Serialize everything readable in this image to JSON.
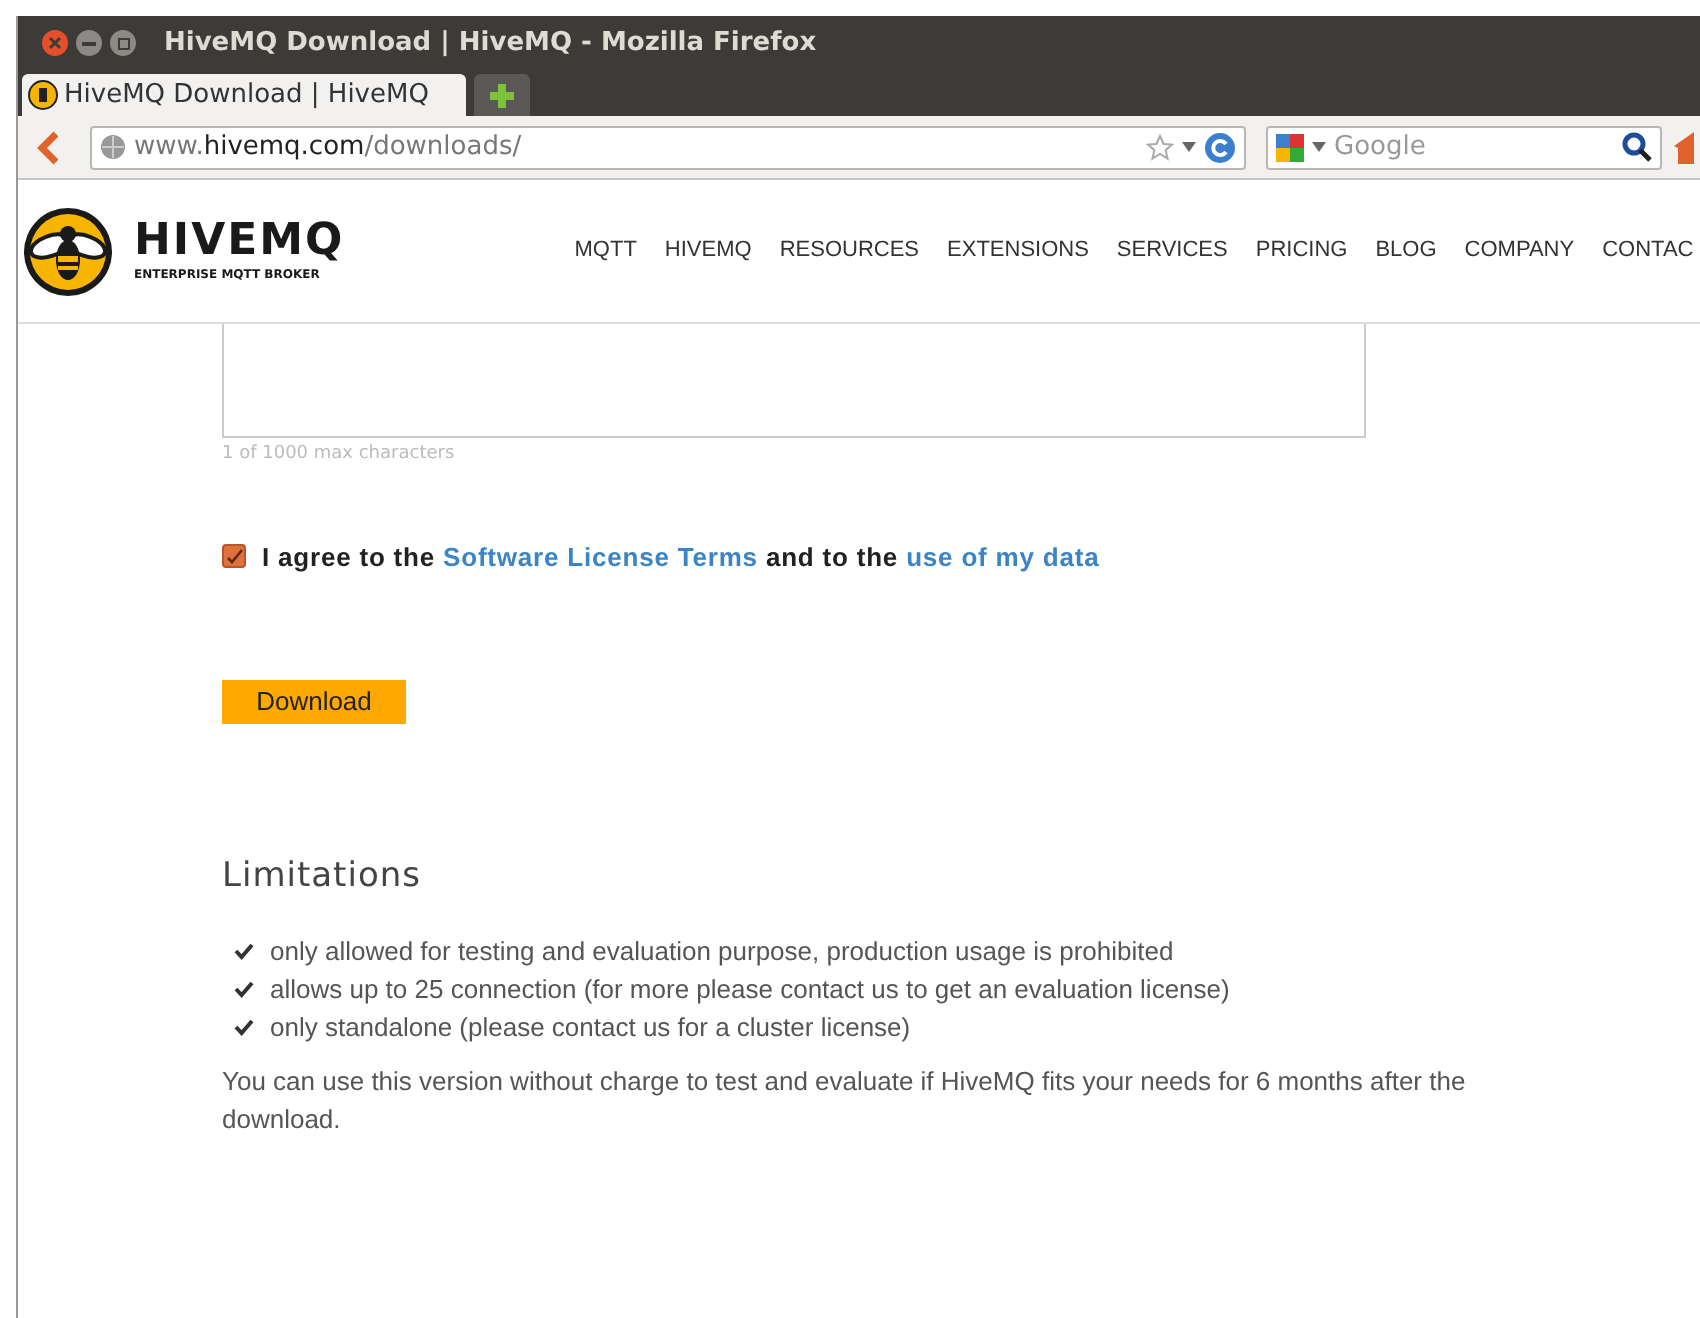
{
  "window": {
    "title": "HiveMQ Download | HiveMQ - Mozilla Firefox"
  },
  "tabs": [
    {
      "label": "HiveMQ Download | HiveMQ",
      "selected": true
    }
  ],
  "address_bar": {
    "host_prefix": "www.",
    "host": "hivemq.com",
    "path": "/downloads/"
  },
  "search": {
    "placeholder": "Google"
  },
  "site": {
    "logo_text": "HIVEMQ",
    "tagline": "ENTERPRISE MQTT BROKER",
    "nav": [
      "MQTT",
      "HIVEMQ",
      "RESOURCES",
      "EXTENSIONS",
      "SERVICES",
      "PRICING",
      "BLOG",
      "COMPANY",
      "CONTAC"
    ]
  },
  "form": {
    "char_count": "1 of 1000 max characters",
    "agree": {
      "checked": true,
      "text_1": "I agree to the",
      "link_1": "Software License Terms",
      "text_2": "and to the",
      "link_2": "use of my data"
    },
    "download_button": "Download"
  },
  "limitations": {
    "heading": "Limitations",
    "items": [
      "only allowed for testing and evaluation purpose, production usage is prohibited",
      "allows up to 25 connection (for more please contact us to get an evaluation license)",
      "only standalone (please contact us for a cluster license)"
    ],
    "note": "You can use this version without charge to test and evaluate if HiveMQ fits your needs for 6 months after the download."
  }
}
